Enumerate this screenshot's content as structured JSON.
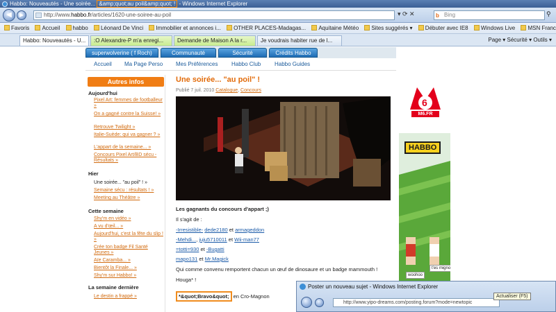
{
  "window": {
    "title_prefix": "Habbo: Nouveautés - Une soirée...",
    "title_highlight": "&amp;quot;au poil&amp;quot; !",
    "title_suffix": " - Windows Internet Explorer"
  },
  "addressbar": {
    "url_prefix": "http://www.",
    "url_domain": "habbo.fr",
    "url_path": "/articles/1620-une-soiree-au-poil",
    "search_placeholder": "Bing"
  },
  "favorites": {
    "label": "Favoris",
    "items": [
      "Accueil",
      "habbo",
      "Léonard De Vinci",
      "Immobilier et annonces i...",
      "OTHER PLACES-Madagas...",
      "Aquitaine Météo",
      "Sites suggérés ▾",
      "Débuter avec IE8",
      "Windows Live",
      "MSN France"
    ]
  },
  "tabs": {
    "items": [
      "Habbo: Nouveautés - U...",
      ":O Alexandre-P m'a enregi...",
      "Demande de Maison A la r...",
      "Je voudrais habiter rue de l..."
    ],
    "commands": "Page ▾   Sécurité ▾   Outils ▾"
  },
  "site": {
    "topnav": [
      "superwolverine ( f Roch)",
      "Communauté",
      "Sécurité",
      "Crédits Habbo"
    ],
    "subnav": [
      "Accueil",
      "Ma Page Perso",
      "Mes Préférences",
      "Habbo Club",
      "Habbo Guides"
    ]
  },
  "sidebar": {
    "heading": "Autres infos",
    "sections": [
      {
        "title": "Aujourd'hui",
        "links": [
          "Pixel Art: femmes de footballeur »",
          "On a gagné contre la Suisse! »",
          "Retrouve Twilight »",
          "Italie-Suède: qui va gagner ? »",
          "L'appart de la semaine... »",
          "Concours Pixel Art/BD sécu - Résultats »"
        ]
      },
      {
        "title": "Hier",
        "links": [
          "Une soirée... \"au poil\" ! »",
          "Semaine sécu : résultats ! »",
          "Meeting au Théâtre »"
        ]
      },
      {
        "title": "Cette semaine",
        "links": [
          "Shy'm en vidéo »",
          "A vu d'œil... »",
          "Aujourd'hui, c'est la fête du slip ! »",
          "Crée ton badge Fil Santé Jeunes »",
          "Aïe Caramba... »",
          "Bientôt la Finale... »",
          "Shy'm sur Habbo! »"
        ]
      },
      {
        "title": "La semaine dernière",
        "links": [
          "Le destin a frappé »"
        ]
      }
    ]
  },
  "article": {
    "title": "Une soirée... \"au poil\" !",
    "meta_prefix": "Publié 7 juil. 2010 ",
    "meta_cat1": "Catalogue",
    "meta_sep": ", ",
    "meta_cat2": "Concours",
    "winners_heading": "Les gagnants du concours d'appart ;)",
    "intro": "Il s'agit de :",
    "w1a": "-Irresistible-",
    "w1b": "dede2180",
    "w1c": "armageddon",
    "w2a": "-Mehdi...",
    "w2b": "juju5710011",
    "w2c": "Wii-man77",
    "w3a": "=totti=930",
    "w3b": "-Bugatti",
    "w4a": "mapo131",
    "w4b": "Mr.Magick",
    "et": "et",
    "prize": "Qui comme convenu remportent chacun un œuf de dinosaure et un badge mammouth !",
    "houga": "Houga* !",
    "bravo_highlight": "*&quot;Bravo&quot;",
    "bravo_suffix": " en Cro-Magnon"
  },
  "ads": {
    "m6_label": "M6.FR",
    "habbo_logo": "HABBO",
    "bubble1": "woohoo",
    "bubble2": "t'es mignon !"
  },
  "popup": {
    "title": "Poster un nouveau sujet - Windows Internet Explorer",
    "url": "http://www.yipo-dreams.com/posting.forum?mode=newtopic",
    "tooltip": "Actualiser (F5)"
  }
}
